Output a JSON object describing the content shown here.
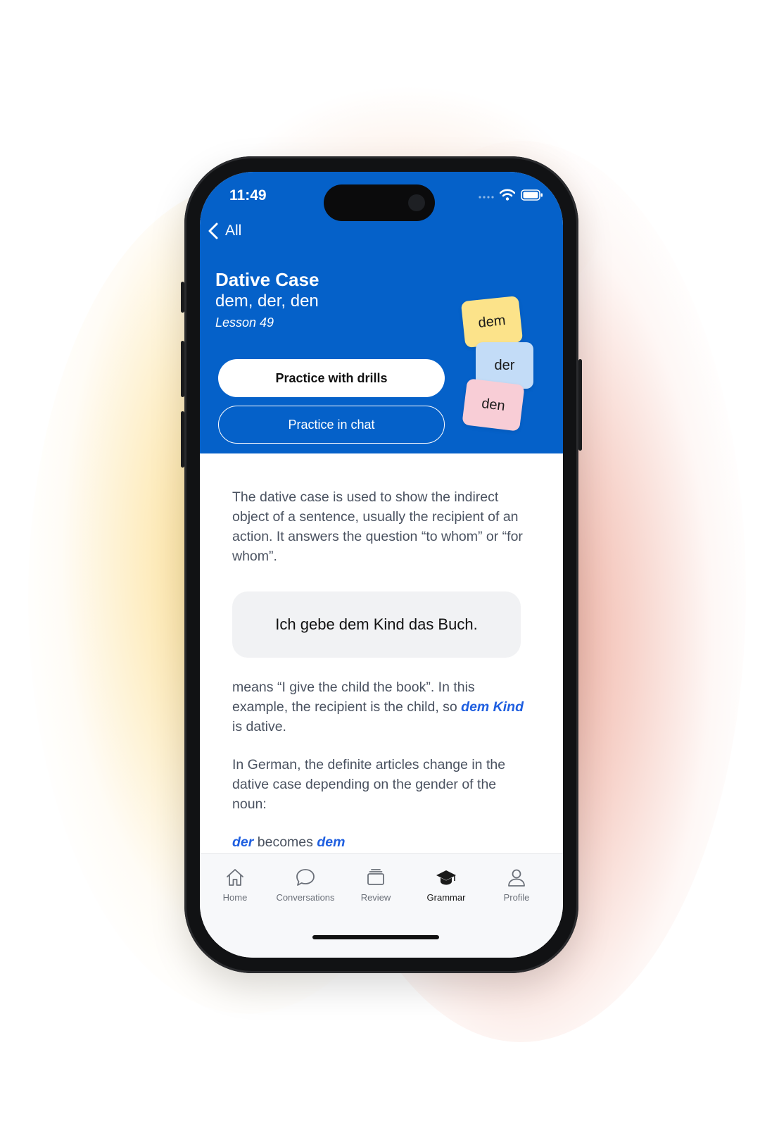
{
  "status_bar": {
    "time": "11:49"
  },
  "nav": {
    "back_label": "All"
  },
  "lesson": {
    "title": "Dative Case",
    "subtitle": "dem, der, den",
    "number_label": "Lesson 49"
  },
  "actions": {
    "drills_label": "Practice with drills",
    "chat_label": "Practice in chat"
  },
  "article_cards": [
    {
      "label": "dem",
      "color": "#fce38a"
    },
    {
      "label": "der",
      "color": "#c3dcf7"
    },
    {
      "label": "den",
      "color": "#f8cdd6"
    }
  ],
  "body": {
    "intro": "The dative case is used to show the indirect object of a sentence, usually the recipient of an action. It answers the question “to whom” or “for whom”.",
    "example": "Ich gebe dem Kind das Buch.",
    "means_prefix": "means “I give the child the book”. In this example, the recipient is the child, so ",
    "means_highlight": "dem Kind",
    "means_suffix": " is dative.",
    "german_intro": "In German, the definite articles change in the dative case depending on the gender of the noun:",
    "rule_from": "der",
    "rule_middle": " becomes ",
    "rule_to": "dem"
  },
  "tabs": [
    {
      "label": "Home",
      "icon": "home-icon",
      "active": false
    },
    {
      "label": "Conversations",
      "icon": "chat-bubble-icon",
      "active": false
    },
    {
      "label": "Review",
      "icon": "cards-stack-icon",
      "active": false
    },
    {
      "label": "Grammar",
      "icon": "graduation-cap-icon",
      "active": true
    },
    {
      "label": "Profile",
      "icon": "person-icon",
      "active": false
    }
  ],
  "colors": {
    "header_blue": "#0561c9",
    "highlight_blue": "#1f5fe0",
    "body_text": "#4a5260",
    "example_bg": "#f1f2f4"
  }
}
